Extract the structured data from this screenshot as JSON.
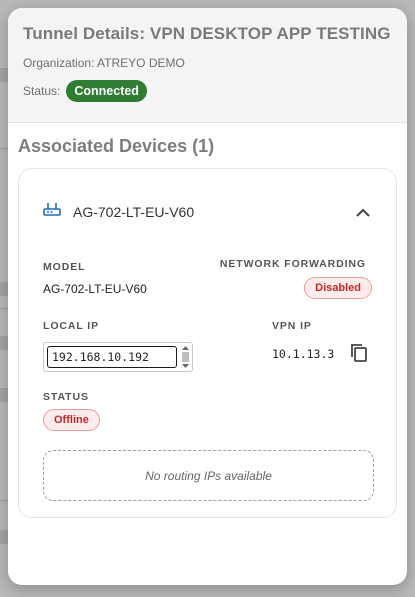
{
  "modal": {
    "title": "Tunnel Details: VPN DESKTOP APP TESTING",
    "organization_label": "Organization:",
    "organization_value": "ATREYO DEMO",
    "status_label": "Status:",
    "status_value": "Connected"
  },
  "devices_section": {
    "title": "Associated Devices (1)"
  },
  "device": {
    "name": "AG-702-LT-EU-V60",
    "model_label": "MODEL",
    "model_value": "AG-702-LT-EU-V60",
    "network_forwarding_label": "NETWORK FORWARDING",
    "network_forwarding_value": "Disabled",
    "local_ip_label": "LOCAL IP",
    "local_ip_value": "192.168.10.192",
    "vpn_ip_label": "VPN IP",
    "vpn_ip_value": "10.1.13.3",
    "status_label": "STATUS",
    "status_value": "Offline",
    "routing_message": "No routing IPs available"
  },
  "colors": {
    "connected": "#2e7d32",
    "disabled_text": "#c62828",
    "router_icon": "#1e6fb8"
  },
  "icons": [
    "router-icon",
    "chevron-up-icon",
    "copy-icon"
  ]
}
